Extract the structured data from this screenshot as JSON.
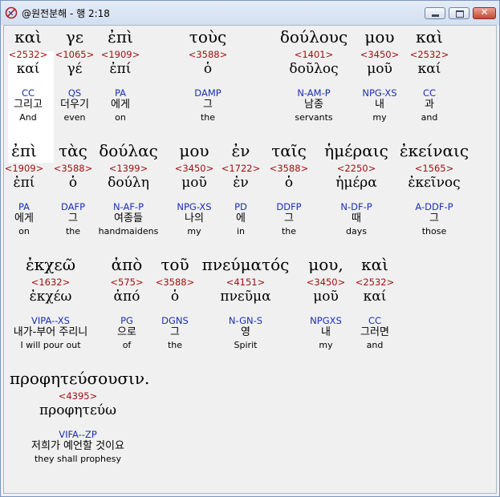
{
  "window": {
    "title": "@원전분해 - 행 2:18"
  },
  "rows": [
    [
      {
        "greek": "καὶ",
        "strong": "<2532>",
        "lemma": "καί",
        "morph": "CC",
        "korean": "그리고",
        "english": "And"
      },
      {
        "greek": "γε",
        "strong": "<1065>",
        "lemma": "γέ",
        "morph": "QS",
        "korean": "더우기",
        "english": "even"
      },
      {
        "greek": "ἐπὶ",
        "strong": "<1909>",
        "lemma": "ἐπί",
        "morph": "PA",
        "korean": "에게",
        "english": "on"
      },
      {
        "greek": "τοὺς",
        "strong": "<3588>",
        "lemma": "ὁ",
        "morph": "DAMP",
        "korean": "그",
        "english": "the"
      },
      {
        "greek": "δούλους",
        "strong": "<1401>",
        "lemma": "δοῦλος",
        "morph": "N-AM-P",
        "korean": "남종",
        "english": "servants"
      },
      {
        "greek": "μου",
        "strong": "<3450>",
        "lemma": "μοῦ",
        "morph": "NPG-XS",
        "korean": "내",
        "english": "my"
      },
      {
        "greek": "καὶ",
        "strong": "<2532>",
        "lemma": "καί",
        "morph": "CC",
        "korean": "과",
        "english": "and"
      }
    ],
    [
      {
        "greek": "ἐπὶ",
        "strong": "<1909>",
        "lemma": "ἐπί",
        "morph": "PA",
        "korean": "에게",
        "english": "on"
      },
      {
        "greek": "τὰς",
        "strong": "<3588>",
        "lemma": "ὁ",
        "morph": "DAFP",
        "korean": "그",
        "english": "the"
      },
      {
        "greek": "δούλας",
        "strong": "<1399>",
        "lemma": "δούλη",
        "morph": "N-AF-P",
        "korean": "여종들",
        "english": "handmaidens"
      },
      {
        "greek": "μου",
        "strong": "<3450>",
        "lemma": "μοῦ",
        "morph": "NPG-XS",
        "korean": "나의",
        "english": "my"
      },
      {
        "greek": "ἐν",
        "strong": "<1722>",
        "lemma": "ἐν",
        "morph": "PD",
        "korean": "에",
        "english": "in"
      },
      {
        "greek": "ταῖς",
        "strong": "<3588>",
        "lemma": "ὁ",
        "morph": "DDFP",
        "korean": "그",
        "english": "the"
      },
      {
        "greek": "ἡμέραις",
        "strong": "<2250>",
        "lemma": "ἡμέρα",
        "morph": "N-DF-P",
        "korean": "때",
        "english": "days"
      },
      {
        "greek": "ἐκείναις",
        "strong": "<1565>",
        "lemma": "ἐκεῖνος",
        "morph": "A-DDF-P",
        "korean": "그",
        "english": "those"
      }
    ],
    [
      {
        "greek": "ἐκχεῶ",
        "strong": "<1632>",
        "lemma": "ἐκχέω",
        "morph": "VIPA--XS",
        "korean": "내가-부어 주리니",
        "english": "I will pour out"
      },
      {
        "greek": "ἀπὸ",
        "strong": "<575>",
        "lemma": "ἀπό",
        "morph": "PG",
        "korean": "으로",
        "english": "of"
      },
      {
        "greek": "τοῦ",
        "strong": "<3588>",
        "lemma": "ὁ",
        "morph": "DGNS",
        "korean": "그",
        "english": "the"
      },
      {
        "greek": "πνεύματός",
        "strong": "<4151>",
        "lemma": "πνεῦμα",
        "morph": "N-GN-S",
        "korean": "영",
        "english": "Spirit"
      },
      {
        "greek": "μου,",
        "strong": "<3450>",
        "lemma": "μοῦ",
        "morph": "NPGXS",
        "korean": "내",
        "english": "my"
      },
      {
        "greek": "καὶ",
        "strong": "<2532>",
        "lemma": "καί",
        "morph": "CC",
        "korean": "그러면",
        "english": "and"
      }
    ],
    [
      {
        "greek": "προφητεύσουσιν.",
        "strong": "<4395>",
        "lemma": "προφητεύω",
        "morph": "VIFA--ZP",
        "korean": "저희가 예언할 것이요",
        "english": "they shall prophesy"
      }
    ]
  ]
}
